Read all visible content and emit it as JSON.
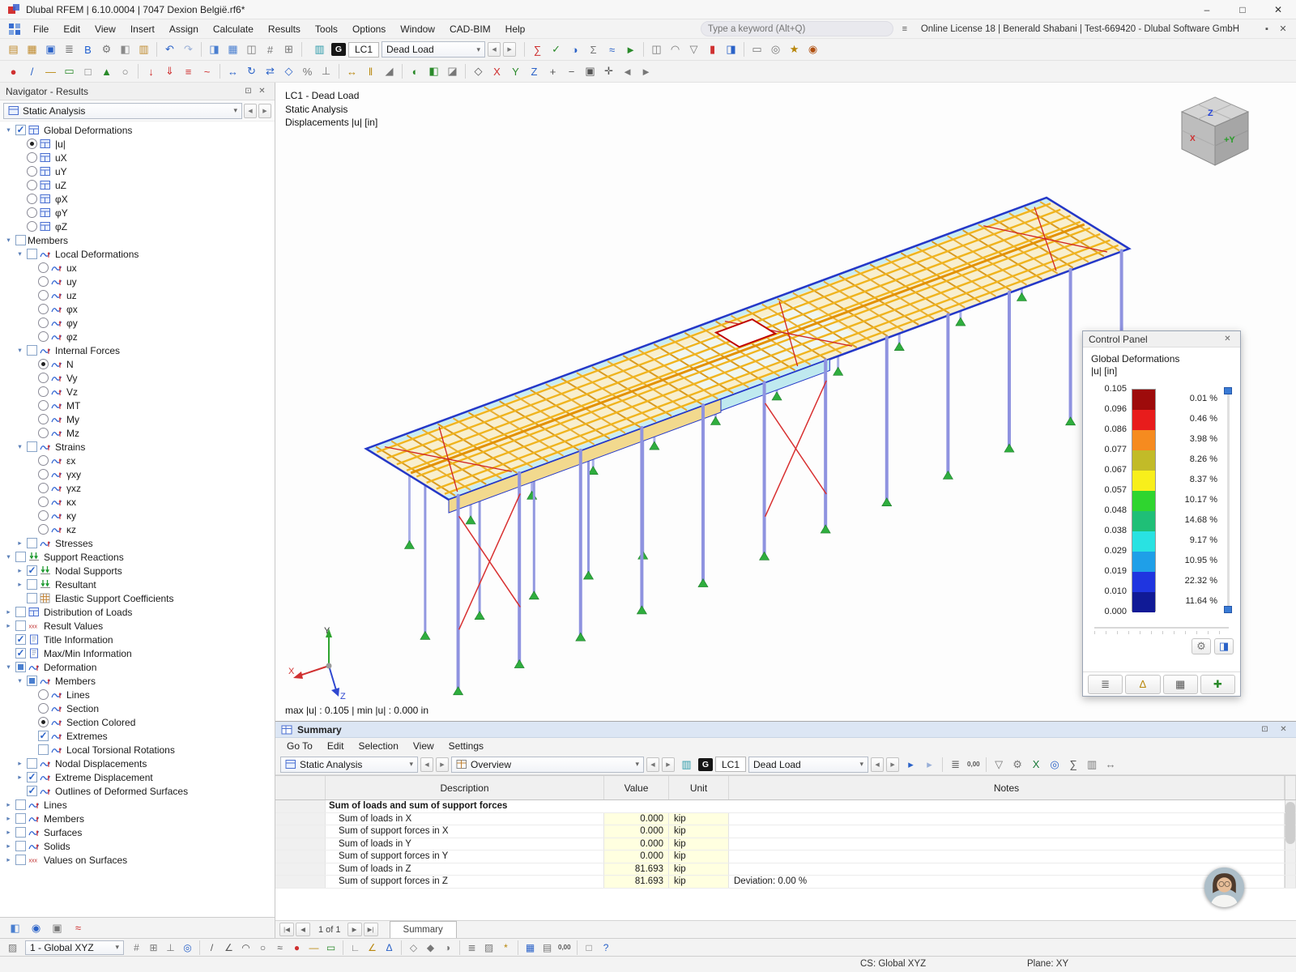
{
  "titlebar": {
    "title": "Dlubal RFEM | 6.10.0004 | 7047 Dexion België.rf6*"
  },
  "menubar": {
    "items": [
      "File",
      "Edit",
      "View",
      "Insert",
      "Assign",
      "Calculate",
      "Results",
      "Tools",
      "Options",
      "Window",
      "CAD-BIM",
      "Help"
    ],
    "search_placeholder": "Type a keyword (Alt+Q)",
    "license": "Online License 18 | Benerald Shabani | Test-669420 - Dlubal Software GmbH"
  },
  "toolbar_main": {
    "lc_badge": "G",
    "lc": "LC1",
    "load_case": "Dead Load"
  },
  "toolbars": {
    "row1_left": [
      [
        "new-model",
        "▤",
        "#bf8a2c"
      ],
      [
        "open-model",
        "▦",
        "#bf8a2c"
      ],
      [
        "save-model",
        "▣",
        "#2a62c8"
      ],
      [
        "print",
        "≣",
        "#666666"
      ],
      [
        "connect-service",
        "B",
        "#1f5fd0"
      ],
      [
        "program-options",
        "⚙",
        "#777777"
      ],
      [
        "copy-object",
        "◧",
        "#8a8a8a"
      ],
      [
        "paste-object",
        "▥",
        "#bf8a2c"
      ],
      [
        "sep"
      ],
      [
        "undo",
        "↶",
        "#2a62c8"
      ],
      [
        "redo",
        "↷",
        "#9ab0d8"
      ],
      [
        "sep"
      ],
      [
        "navigator-toggle",
        "◨",
        "#4a7fd0"
      ],
      [
        "tables-toggle",
        "▦",
        "#4a7fd0"
      ],
      [
        "split-view",
        "◫",
        "#777777"
      ],
      [
        "snap-settings",
        "#",
        "#777777"
      ],
      [
        "work-plane",
        "⊞",
        "#777777"
      ],
      [
        "sep"
      ]
    ],
    "row1_right": [
      [
        "sep"
      ],
      [
        "calculate-all",
        "∑",
        "#cf3030"
      ],
      [
        "check-model",
        "✓",
        "#2a8a2a"
      ],
      [
        "results-toggle",
        "◑",
        "#2a62c8"
      ],
      [
        "result-values",
        "Σ",
        "#777777"
      ],
      [
        "deformed-shape",
        "≈",
        "#2a62c8"
      ],
      [
        "animate-results",
        "►",
        "#2a8a2a"
      ],
      [
        "sep"
      ],
      [
        "section-view",
        "◫",
        "#777777"
      ],
      [
        "smooth-diagram",
        "◠",
        "#777777"
      ],
      [
        "filter-results",
        "▽",
        "#777777"
      ],
      [
        "color-scale-toggle",
        "▮",
        "#cf3030"
      ],
      [
        "panel-toggle",
        "◨",
        "#2a62c8"
      ],
      [
        "sep"
      ],
      [
        "clipping-box",
        "▭",
        "#777777"
      ],
      [
        "visibility-modes",
        "◎",
        "#777777"
      ],
      [
        "saved-views",
        "★",
        "#b8860b"
      ],
      [
        "render-mode",
        "◉",
        "#b05010"
      ]
    ],
    "row2": [
      [
        "node-new",
        "●",
        "#cf3030"
      ],
      [
        "line-new",
        "/",
        "#2a62c8"
      ],
      [
        "member-new",
        "—",
        "#b8860b"
      ],
      [
        "surface-new",
        "▭",
        "#2a8a2a"
      ],
      [
        "opening-new",
        "□",
        "#777777"
      ],
      [
        "support-new",
        "▲",
        "#2a8a2a"
      ],
      [
        "hinge-new",
        "○",
        "#777777"
      ],
      [
        "sep"
      ],
      [
        "nodal-load",
        "↓",
        "#cf3030"
      ],
      [
        "member-load",
        "⇓",
        "#cf3030"
      ],
      [
        "surface-load",
        "≡",
        "#cf3030"
      ],
      [
        "imperfection",
        "~",
        "#cf3030"
      ],
      [
        "sep"
      ],
      [
        "move-copy",
        "↔",
        "#2a62c8"
      ],
      [
        "rotate",
        "↻",
        "#2a62c8"
      ],
      [
        "mirror",
        "⇄",
        "#2a62c8"
      ],
      [
        "scale-tool",
        "◇",
        "#2a62c8"
      ],
      [
        "divide",
        "%",
        "#777777"
      ],
      [
        "connect-members",
        "⊥",
        "#777777"
      ],
      [
        "sep"
      ],
      [
        "dimensions",
        "↔",
        "#b8860b"
      ],
      [
        "guidelines",
        "‖",
        "#b8860b"
      ],
      [
        "section-cut",
        "◢",
        "#777777"
      ],
      [
        "sep"
      ],
      [
        "visibility-on",
        "◐",
        "#2a8a2a"
      ],
      [
        "isolate-selection",
        "◧",
        "#2a8a2a"
      ],
      [
        "clip-plane",
        "◪",
        "#777777"
      ],
      [
        "sep"
      ],
      [
        "view-isometric",
        "◇",
        "#555555"
      ],
      [
        "view-along-x",
        "X",
        "#cf3030"
      ],
      [
        "view-along-y",
        "Y",
        "#2a8a2a"
      ],
      [
        "view-along-z",
        "Z",
        "#2a62c8"
      ],
      [
        "zoom-in",
        "+",
        "#555555"
      ],
      [
        "zoom-out",
        "−",
        "#555555"
      ],
      [
        "zoom-window",
        "▣",
        "#555555"
      ],
      [
        "pan-view",
        "✛",
        "#555555"
      ],
      [
        "previous-view",
        "◄",
        "#777777"
      ],
      [
        "next-view",
        "►",
        "#777777"
      ]
    ],
    "bottom": [
      [
        "snap-toggle",
        "#",
        "#777777"
      ],
      [
        "grid-toggle",
        "⊞",
        "#777777"
      ],
      [
        "ortho-toggle",
        "⊥",
        "#777777"
      ],
      [
        "object-snap",
        "◎",
        "#2a62c8"
      ],
      [
        "sep"
      ],
      [
        "draw-line",
        "/",
        "#555555"
      ],
      [
        "draw-polyline",
        "∠",
        "#555555"
      ],
      [
        "draw-arc",
        "◠",
        "#555555"
      ],
      [
        "draw-circle",
        "○",
        "#555555"
      ],
      [
        "draw-spline",
        "≈",
        "#555555"
      ],
      [
        "draw-node",
        "●",
        "#cf3030"
      ],
      [
        "draw-member",
        "—",
        "#b8860b"
      ],
      [
        "draw-rect",
        "▭",
        "#2a8a2a"
      ],
      [
        "sep"
      ],
      [
        "measure-distance",
        "∟",
        "#777777"
      ],
      [
        "measure-angle",
        "∠",
        "#b8860b"
      ],
      [
        "coordinate-input",
        "Δ",
        "#2a62c8"
      ],
      [
        "sep"
      ],
      [
        "wireframe",
        "◇",
        "#777777"
      ],
      [
        "solid-display",
        "◆",
        "#777777"
      ],
      [
        "shaded-display",
        "◑",
        "#777777"
      ],
      [
        "sep"
      ],
      [
        "layers",
        "≣",
        "#777777"
      ],
      [
        "background-color",
        "▨",
        "#777777"
      ],
      [
        "light-settings",
        "*",
        "#b8860b"
      ],
      [
        "sep"
      ],
      [
        "open-tables",
        "▦",
        "#2a62c8"
      ],
      [
        "printout-report",
        "▤",
        "#777777"
      ],
      [
        "rounding",
        "0,00",
        "#555555"
      ],
      [
        "sep"
      ],
      [
        "fullscreen",
        "□",
        "#777777"
      ],
      [
        "help-status",
        "?",
        "#2a62c8"
      ]
    ],
    "summary": [
      [
        "select-row-mode",
        "▸",
        "#2a62c8"
      ],
      [
        "pointer-sync",
        "▸",
        "#9ab0d8"
      ],
      [
        "sep"
      ],
      [
        "print-table",
        "≣",
        "#555555"
      ],
      [
        "number-format",
        "0,00",
        "#555555"
      ],
      [
        "sep"
      ],
      [
        "filter-table",
        "▽",
        "#777777"
      ],
      [
        "table-settings",
        "⚙",
        "#777777"
      ],
      [
        "export-excel",
        "X",
        "#1a7a3a"
      ],
      [
        "search-table",
        "◎",
        "#2a62c8"
      ],
      [
        "sum-row",
        "∑",
        "#555555"
      ],
      [
        "columns-config",
        "▥",
        "#777777"
      ],
      [
        "fit-columns",
        "↔",
        "#777777"
      ]
    ],
    "nav_foot": [
      [
        "navigator-data",
        "◧",
        "#4a7fd0"
      ],
      [
        "navigator-display",
        "◉",
        "#2a62c8"
      ],
      [
        "navigator-views",
        "▣",
        "#777777"
      ],
      [
        "navigator-results",
        "≈",
        "#cf3030"
      ]
    ],
    "cp_side": [
      [
        "panel-settings",
        "⚙",
        "#777777"
      ],
      [
        "panel-dock",
        "◨",
        "#2a62c8"
      ]
    ],
    "cp_foot": [
      [
        "legend-tab",
        "≣",
        "#555555"
      ],
      [
        "scale-tab",
        "Δ",
        "#b8860b"
      ],
      [
        "isobands-tab",
        "▦",
        "#555555"
      ],
      [
        "colors-tab",
        "✚",
        "#2a8a2a"
      ]
    ]
  },
  "navigator": {
    "title": "Navigator - Results",
    "analysis_combo": "Static Analysis",
    "tree": [
      {
        "l": "Global Deformations",
        "v": 0,
        "c": "cb",
        "s": "on",
        "e": "o",
        "i": "win"
      },
      {
        "l": "|u|",
        "v": 1,
        "c": "rb",
        "s": "sel",
        "e": "",
        "i": "win"
      },
      {
        "l": "uX",
        "v": 1,
        "c": "rb",
        "s": "un",
        "e": "",
        "i": "win"
      },
      {
        "l": "uY",
        "v": 1,
        "c": "rb",
        "s": "un",
        "e": "",
        "i": "win"
      },
      {
        "l": "uZ",
        "v": 1,
        "c": "rb",
        "s": "un",
        "e": "",
        "i": "win"
      },
      {
        "l": "φX",
        "v": 1,
        "c": "rb",
        "s": "un",
        "e": "",
        "i": "win"
      },
      {
        "l": "φY",
        "v": 1,
        "c": "rb",
        "s": "un",
        "e": "",
        "i": "win"
      },
      {
        "l": "φZ",
        "v": 1,
        "c": "rb",
        "s": "un",
        "e": "",
        "i": "win"
      },
      {
        "l": "Members",
        "v": 0,
        "c": "cb",
        "s": "off",
        "e": "o",
        "i": ""
      },
      {
        "l": "Local Deformations",
        "v": 1,
        "c": "cb",
        "s": "off",
        "e": "o",
        "i": "def"
      },
      {
        "l": "ux",
        "v": 2,
        "c": "rb",
        "s": "un",
        "e": "",
        "i": "def"
      },
      {
        "l": "uy",
        "v": 2,
        "c": "rb",
        "s": "un",
        "e": "",
        "i": "def"
      },
      {
        "l": "uz",
        "v": 2,
        "c": "rb",
        "s": "un",
        "e": "",
        "i": "def"
      },
      {
        "l": "φx",
        "v": 2,
        "c": "rb",
        "s": "un",
        "e": "",
        "i": "def"
      },
      {
        "l": "φy",
        "v": 2,
        "c": "rb",
        "s": "un",
        "e": "",
        "i": "def"
      },
      {
        "l": "φz",
        "v": 2,
        "c": "rb",
        "s": "un",
        "e": "",
        "i": "def"
      },
      {
        "l": "Internal Forces",
        "v": 1,
        "c": "cb",
        "s": "off",
        "e": "o",
        "i": "def"
      },
      {
        "l": "N",
        "v": 2,
        "c": "rb",
        "s": "sel",
        "e": "",
        "i": "def"
      },
      {
        "l": "Vy",
        "v": 2,
        "c": "rb",
        "s": "un",
        "e": "",
        "i": "def"
      },
      {
        "l": "Vz",
        "v": 2,
        "c": "rb",
        "s": "un",
        "e": "",
        "i": "def"
      },
      {
        "l": "MT",
        "v": 2,
        "c": "rb",
        "s": "un",
        "e": "",
        "i": "def"
      },
      {
        "l": "My",
        "v": 2,
        "c": "rb",
        "s": "un",
        "e": "",
        "i": "def"
      },
      {
        "l": "Mz",
        "v": 2,
        "c": "rb",
        "s": "un",
        "e": "",
        "i": "def"
      },
      {
        "l": "Strains",
        "v": 1,
        "c": "cb",
        "s": "off",
        "e": "o",
        "i": "def"
      },
      {
        "l": "εx",
        "v": 2,
        "c": "rb",
        "s": "un",
        "e": "",
        "i": "def"
      },
      {
        "l": "γxy",
        "v": 2,
        "c": "rb",
        "s": "un",
        "e": "",
        "i": "def"
      },
      {
        "l": "γxz",
        "v": 2,
        "c": "rb",
        "s": "un",
        "e": "",
        "i": "def"
      },
      {
        "l": "κx",
        "v": 2,
        "c": "rb",
        "s": "un",
        "e": "",
        "i": "def"
      },
      {
        "l": "κy",
        "v": 2,
        "c": "rb",
        "s": "un",
        "e": "",
        "i": "def"
      },
      {
        "l": "κz",
        "v": 2,
        "c": "rb",
        "s": "un",
        "e": "",
        "i": "def"
      },
      {
        "l": "Stresses",
        "v": 1,
        "c": "cb",
        "s": "off",
        "e": "c",
        "i": "def"
      },
      {
        "l": "Support Reactions",
        "v": 0,
        "c": "cb",
        "s": "off",
        "e": "o",
        "i": "supp"
      },
      {
        "l": "Nodal Supports",
        "v": 1,
        "c": "cb",
        "s": "on",
        "e": "c",
        "i": "supp"
      },
      {
        "l": "Resultant",
        "v": 1,
        "c": "cb",
        "s": "off",
        "e": "c",
        "i": "supp"
      },
      {
        "l": "Elastic Support Coefficients",
        "v": 1,
        "c": "cb",
        "s": "off",
        "e": "",
        "i": "grid"
      },
      {
        "l": "Distribution of Loads",
        "v": 0,
        "c": "cb",
        "s": "off",
        "e": "c",
        "i": "win"
      },
      {
        "l": "Result Values",
        "v": 0,
        "c": "cb",
        "s": "off",
        "e": "c",
        "i": "xxx"
      },
      {
        "l": "Title Information",
        "v": 0,
        "c": "cb",
        "s": "on",
        "e": "",
        "i": "info"
      },
      {
        "l": "Max/Min Information",
        "v": 0,
        "c": "cb",
        "s": "on",
        "e": "",
        "i": "info"
      },
      {
        "l": "Deformation",
        "v": 0,
        "c": "cb",
        "s": "mix",
        "e": "o",
        "i": "def"
      },
      {
        "l": "Members",
        "v": 1,
        "c": "cb",
        "s": "mix",
        "e": "o",
        "i": "def"
      },
      {
        "l": "Lines",
        "v": 2,
        "c": "rb",
        "s": "un",
        "e": "",
        "i": "def"
      },
      {
        "l": "Section",
        "v": 2,
        "c": "rb",
        "s": "un",
        "e": "",
        "i": "def"
      },
      {
        "l": "Section Colored",
        "v": 2,
        "c": "rb",
        "s": "sel",
        "e": "",
        "i": "def"
      },
      {
        "l": "Extremes",
        "v": 2,
        "c": "cb",
        "s": "on",
        "e": "",
        "i": "def"
      },
      {
        "l": "Local Torsional Rotations",
        "v": 2,
        "c": "cb",
        "s": "off",
        "e": "",
        "i": "def"
      },
      {
        "l": "Nodal Displacements",
        "v": 1,
        "c": "cb",
        "s": "off",
        "e": "c",
        "i": "def"
      },
      {
        "l": "Extreme Displacement",
        "v": 1,
        "c": "cb",
        "s": "on",
        "e": "c",
        "i": "def"
      },
      {
        "l": "Outlines of Deformed Surfaces",
        "v": 1,
        "c": "cb",
        "s": "on",
        "e": "",
        "i": "def"
      },
      {
        "l": "Lines",
        "v": 0,
        "c": "cb",
        "s": "off",
        "e": "c",
        "i": "def"
      },
      {
        "l": "Members",
        "v": 0,
        "c": "cb",
        "s": "off",
        "e": "c",
        "i": "def"
      },
      {
        "l": "Surfaces",
        "v": 0,
        "c": "cb",
        "s": "off",
        "e": "c",
        "i": "def"
      },
      {
        "l": "Solids",
        "v": 0,
        "c": "cb",
        "s": "off",
        "e": "c",
        "i": "def"
      },
      {
        "l": "Values on Surfaces",
        "v": 0,
        "c": "cb",
        "s": "off",
        "e": "c",
        "i": "xxx"
      }
    ]
  },
  "viewport": {
    "lines": [
      "LC1 - Dead Load",
      "Static Analysis",
      "Displacements |u| [in]"
    ],
    "maxmin": "max |u| : 0.105 | min |u| : 0.000 in",
    "axis": {
      "x": "X",
      "y": "Y",
      "z": "Z"
    },
    "cube": {
      "top": "Z",
      "front": "+Y",
      "side": "X"
    }
  },
  "control_panel": {
    "title": "Control Panel",
    "group": "Global Deformations",
    "unit": "|u| [in]",
    "values": [
      "0.105",
      "0.096",
      "0.086",
      "0.077",
      "0.067",
      "0.057",
      "0.048",
      "0.038",
      "0.029",
      "0.019",
      "0.010",
      "0.000"
    ],
    "bands": [
      {
        "color": "#9e0b0b",
        "pct": "0.01 %"
      },
      {
        "color": "#e81c1c",
        "pct": "0.46 %"
      },
      {
        "color": "#f68b1f",
        "pct": "3.98 %"
      },
      {
        "color": "#c2bb28",
        "pct": "8.26 %"
      },
      {
        "color": "#f8ef1b",
        "pct": "8.37 %"
      },
      {
        "color": "#2fd52f",
        "pct": "10.17 %"
      },
      {
        "color": "#1fbf77",
        "pct": "14.68 %"
      },
      {
        "color": "#29e2e2",
        "pct": "9.17 %"
      },
      {
        "color": "#1f9fe8",
        "pct": "10.95 %"
      },
      {
        "color": "#1f35e0",
        "pct": "22.32 %"
      },
      {
        "color": "#101a96",
        "pct": "11.64 %"
      }
    ]
  },
  "summary": {
    "title": "Summary",
    "menus": [
      "Go To",
      "Edit",
      "Selection",
      "View",
      "Settings"
    ],
    "analysis": "Static Analysis",
    "view": "Overview",
    "lc_badge": "G",
    "lc": "LC1",
    "load_case": "Dead Load",
    "table": {
      "headers": [
        "Description",
        "Value",
        "Unit",
        "Notes"
      ],
      "rows": [
        {
          "sec": "Sum of loads and sum of support forces"
        },
        {
          "d": "Sum of loads in X",
          "v": "0.000",
          "u": "kip",
          "n": ""
        },
        {
          "d": "Sum of support forces in X",
          "v": "0.000",
          "u": "kip",
          "n": ""
        },
        {
          "d": "Sum of loads in Y",
          "v": "0.000",
          "u": "kip",
          "n": ""
        },
        {
          "d": "Sum of support forces in Y",
          "v": "0.000",
          "u": "kip",
          "n": ""
        },
        {
          "d": "Sum of loads in Z",
          "v": "81.693",
          "u": "kip",
          "n": ""
        },
        {
          "d": "Sum of support forces in Z",
          "v": "81.693",
          "u": "kip",
          "n": "Deviation: 0.00 %"
        }
      ]
    },
    "pager": "1 of 1",
    "tab": "Summary"
  },
  "bottombar": {
    "combo": "1 - Global XYZ"
  },
  "statusbar": {
    "cs": "CS: Global XYZ",
    "plane": "Plane: XY"
  }
}
